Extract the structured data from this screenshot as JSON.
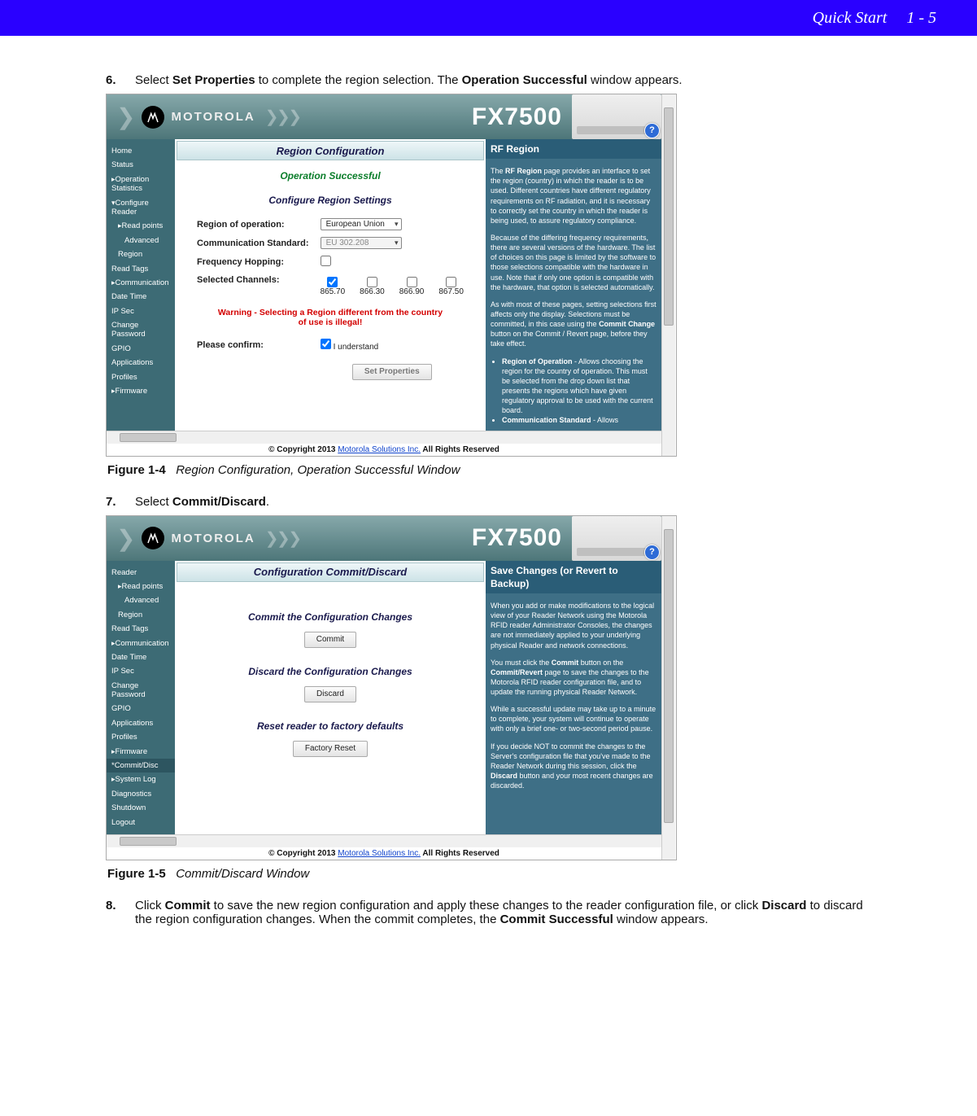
{
  "header": {
    "section": "Quick Start",
    "pageref": "1 - 5"
  },
  "step6": {
    "num": "6.",
    "pre": "Select ",
    "action": "Set Properties",
    "mid": " to complete the region selection. The ",
    "win": "Operation Successful",
    "post": " window appears."
  },
  "fig1": {
    "label": "Figure 1-4",
    "title": "Region Configuration, Operation Successful Window"
  },
  "banner": {
    "brand": "MOTOROLA",
    "product": "FX7500",
    "chev": "❯",
    "chevs": "❯ ❯ ❯"
  },
  "ss1": {
    "sidebar": [
      "Home",
      "Status",
      "Operation Statistics",
      "Configure Reader",
      "Read points",
      "Advanced",
      "Region",
      "Read Tags",
      "Communication",
      "Date Time",
      "IP Sec",
      "Change Password",
      "GPIO",
      "Applications",
      "Profiles",
      "Firmware"
    ],
    "title": "Region Configuration",
    "success": "Operation Successful",
    "section": "Configure Region Settings",
    "rows": {
      "region_label": "Region of operation:",
      "region_value": "European Union",
      "comm_label": "Communication Standard:",
      "comm_value": "EU 302.208",
      "freq_label": "Frequency Hopping:",
      "sel_label": "Selected Channels:",
      "channels": [
        "865.70",
        "866.30",
        "866.90",
        "867.50"
      ],
      "warn": "Warning - Selecting a Region different from the country of use is illegal!",
      "confirm_label": "Please confirm:",
      "confirm_text": "I understand",
      "btn": "Set Properties"
    },
    "info": {
      "title": "RF Region",
      "p1a": "The ",
      "p1b": "RF Region",
      "p1c": " page provides an interface to set the region (country) in which the reader is to be used. Different countries have different regulatory requirements on RF radiation, and it is necessary to correctly set the country in which the reader is being used, to assure regulatory compliance.",
      "p2": "Because of the differing frequency requirements, there are several versions of the hardware. The list of choices on this page is limited by the software to those selections compatible with the hardware in use. Note that if only one option is compatible with the hardware, that option is selected automatically.",
      "p3a": "As with most of these pages, setting selections first affects only the display. Selections must be committed, in this case using the ",
      "p3b": "Commit Change",
      "p3c": " button on the Commit / Revert page, before they take effect.",
      "b1a": "Region of Operation",
      "b1b": " - Allows choosing the region for the country of operation. This must be selected from the drop down list that presents the regions which have given regulatory approval to be used with the current board.",
      "b2a": "Communication Standard",
      "b2b": " - Allows"
    },
    "footer": {
      "pre": "© Copyright 2013 ",
      "link": "Motorola Solutions Inc.",
      "post": " All Rights Reserved"
    }
  },
  "step7": {
    "num": "7.",
    "pre": "Select ",
    "action": "Commit/Discard",
    "post": "."
  },
  "fig2": {
    "label": "Figure 1-5",
    "title": "Commit/Discard Window"
  },
  "ss2": {
    "sidebar": [
      "Reader",
      "Read points",
      "Advanced",
      "Region",
      "Read Tags",
      "Communication",
      "Date Time",
      "IP Sec",
      "Change Password",
      "GPIO",
      "Applications",
      "Profiles",
      "Firmware",
      "*Commit/Disc",
      "System Log",
      "Diagnostics",
      "Shutdown",
      "Logout"
    ],
    "title": "Configuration Commit/Discard",
    "sec1": "Commit the Configuration Changes",
    "btn1": "Commit",
    "sec2": "Discard the Configuration Changes",
    "btn2": "Discard",
    "sec3": "Reset reader to factory defaults",
    "btn3": "Factory Reset",
    "info": {
      "title": "Save Changes (or Revert to Backup)",
      "p1": "When you add or make modifications to the logical view of your Reader Network using the Motorola RFID reader Administrator Consoles, the changes are not immediately applied to your underlying physical Reader and network connections.",
      "p2a": "You must click the ",
      "p2b": "Commit",
      "p2c": " button on the ",
      "p2d": "Commit/Revert",
      "p2e": " page to save the changes to the Motorola RFID reader configuration file, and to update the running physical Reader Network.",
      "p3": "While a successful update may take up to a minute to complete, your system will continue to operate with only a brief one- or two-second period pause.",
      "p4a": "If you decide NOT to commit the changes to the Server's configuration file that you've made to the Reader Network during this session, click the ",
      "p4b": "Discard",
      "p4c": " button and your most recent changes are discarded."
    }
  },
  "step8": {
    "num": "8.",
    "pre": "Click ",
    "a1": "Commit",
    "m1": " to save the new region configuration and apply these changes to the reader configuration file, or click ",
    "a2": "Discard",
    "m2": " to discard the region configuration changes. When the commit completes, the ",
    "a3": "Commit Successful",
    "m3": " window appears."
  }
}
